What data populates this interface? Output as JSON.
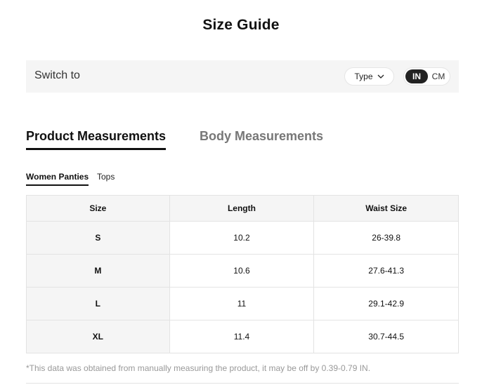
{
  "title": "Size Guide",
  "switch_bar": {
    "label": "Switch to",
    "type_dropdown": "Type",
    "units": {
      "active": "IN",
      "inactive": "CM"
    }
  },
  "main_tabs": [
    {
      "label": "Product Measurements",
      "active": true
    },
    {
      "label": "Body Measurements",
      "active": false
    }
  ],
  "sub_tabs": [
    {
      "label": "Women Panties",
      "active": true
    },
    {
      "label": "Tops",
      "active": false
    }
  ],
  "table": {
    "headers": [
      "Size",
      "Length",
      "Waist Size"
    ],
    "rows": [
      [
        "S",
        "10.2",
        "26-39.8"
      ],
      [
        "M",
        "10.6",
        "27.6-41.3"
      ],
      [
        "L",
        "11",
        "29.1-42.9"
      ],
      [
        "XL",
        "11.4",
        "30.7-44.5"
      ]
    ]
  },
  "note": "*This data was obtained from manually measuring the product, it may be off by 0.39-0.79 IN.",
  "icons": {
    "dropdown": "chevron-down-icon"
  },
  "colors": {
    "accent": "#222222",
    "panel": "#f5f5f5",
    "muted": "#999999"
  }
}
